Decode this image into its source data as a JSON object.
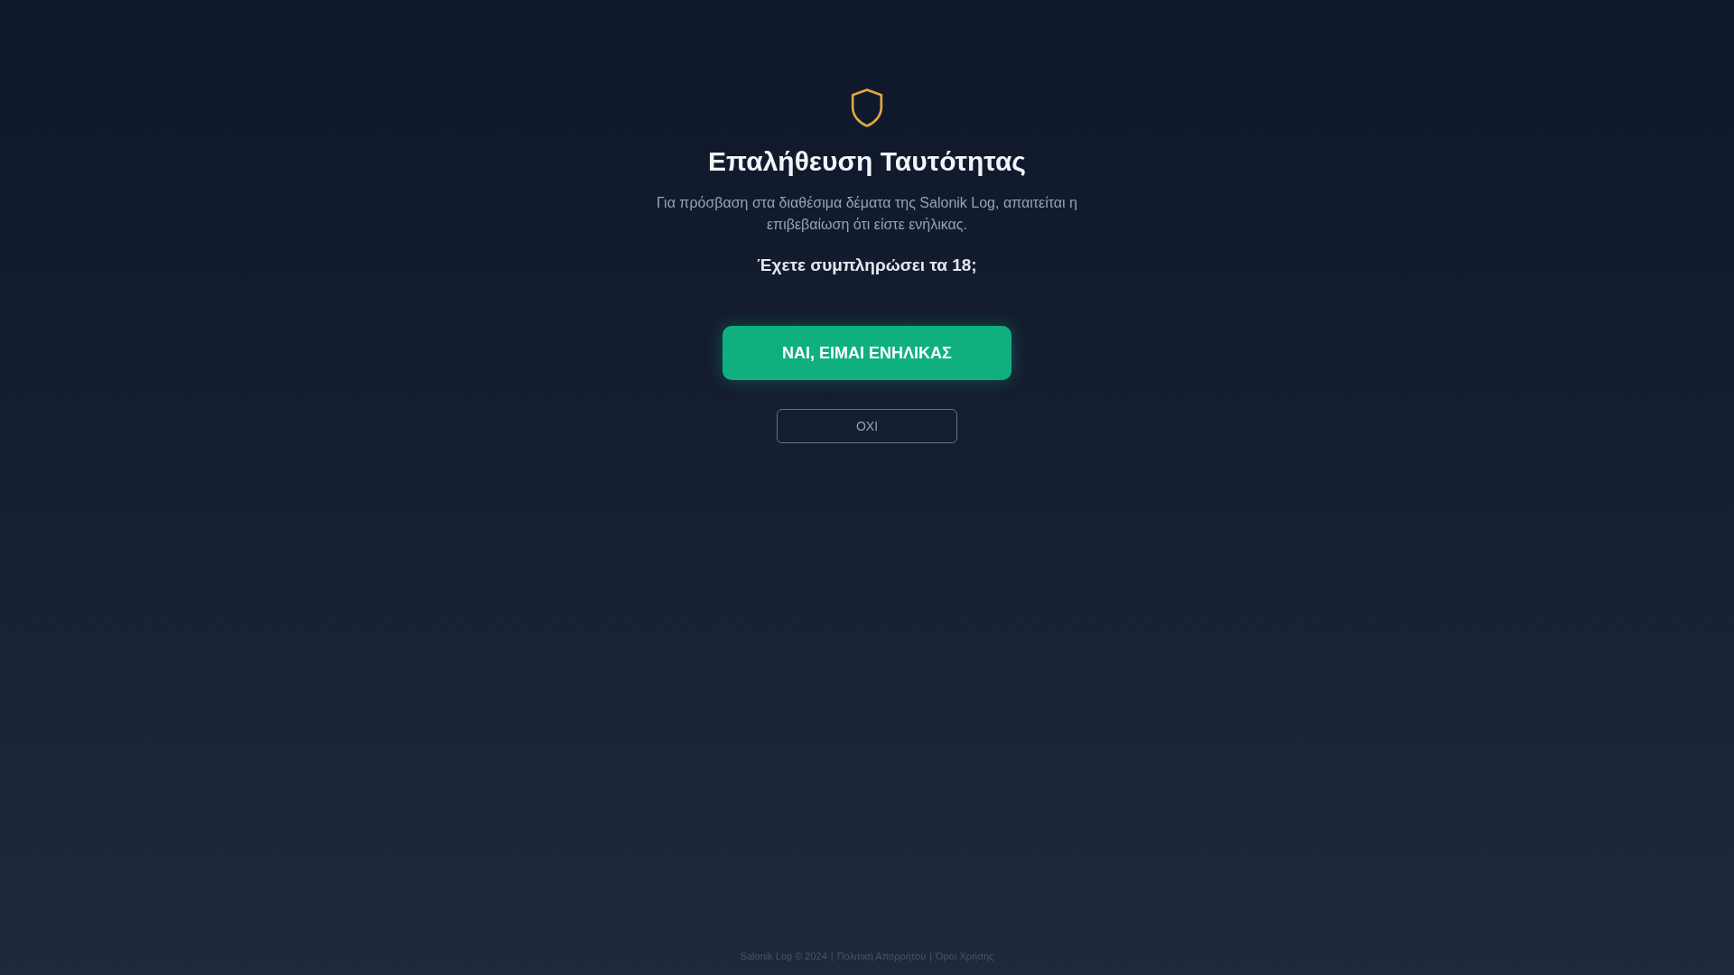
{
  "title": "Επαλήθευση Ταυτότητας",
  "description": "Για πρόσβαση στα διαθέσιμα δέματα της Salonik Log, απαιτείται η επιβεβαίωση ότι είστε ενήλικας.",
  "question": "Έχετε συμπληρώσει τα 18;",
  "buttons": [
    {
      "kind": "primary",
      "label": "ΝΑΙ, ΕΙΜΑΙ ΕΝΗΛΙΚΑΣ"
    },
    {
      "kind": "outline",
      "label": "ΟΧΙ"
    }
  ],
  "footer": {
    "copyright": "Salonik Log © 2024",
    "separator": "|",
    "links": [
      "Πολιτική Απορρήτου",
      "Όροι Χρήσης"
    ]
  }
}
